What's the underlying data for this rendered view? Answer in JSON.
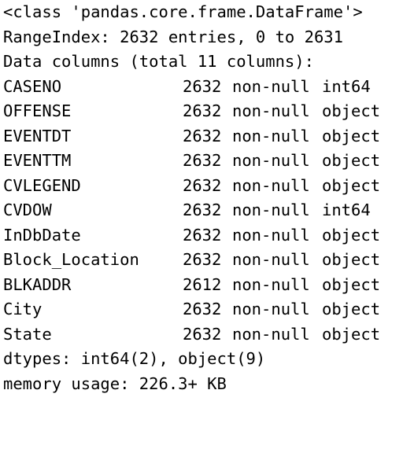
{
  "header": {
    "class_line": "<class 'pandas.core.frame.DataFrame'>",
    "range_index": "RangeIndex: 2632 entries, 0 to 2631",
    "data_columns": "Data columns (total 11 columns):"
  },
  "columns": [
    {
      "name": "CASENO",
      "count": "2632",
      "nonnull": "non-null",
      "dtype": "int64"
    },
    {
      "name": "OFFENSE",
      "count": "2632",
      "nonnull": "non-null",
      "dtype": "object"
    },
    {
      "name": "EVENTDT",
      "count": "2632",
      "nonnull": "non-null",
      "dtype": "object"
    },
    {
      "name": "EVENTTM",
      "count": "2632",
      "nonnull": "non-null",
      "dtype": "object"
    },
    {
      "name": "CVLEGEND",
      "count": "2632",
      "nonnull": "non-null",
      "dtype": "object"
    },
    {
      "name": "CVDOW",
      "count": "2632",
      "nonnull": "non-null",
      "dtype": "int64"
    },
    {
      "name": "InDbDate",
      "count": "2632",
      "nonnull": "non-null",
      "dtype": "object"
    },
    {
      "name": "Block_Location",
      "count": "2632",
      "nonnull": "non-null",
      "dtype": "object"
    },
    {
      "name": "BLKADDR",
      "count": "2612",
      "nonnull": "non-null",
      "dtype": "object"
    },
    {
      "name": "City",
      "count": "2632",
      "nonnull": "non-null",
      "dtype": "object"
    },
    {
      "name": "State",
      "count": "2632",
      "nonnull": "non-null",
      "dtype": "object"
    }
  ],
  "footer": {
    "dtypes": "dtypes: int64(2), object(9)",
    "memory": "memory usage: 226.3+ KB"
  }
}
